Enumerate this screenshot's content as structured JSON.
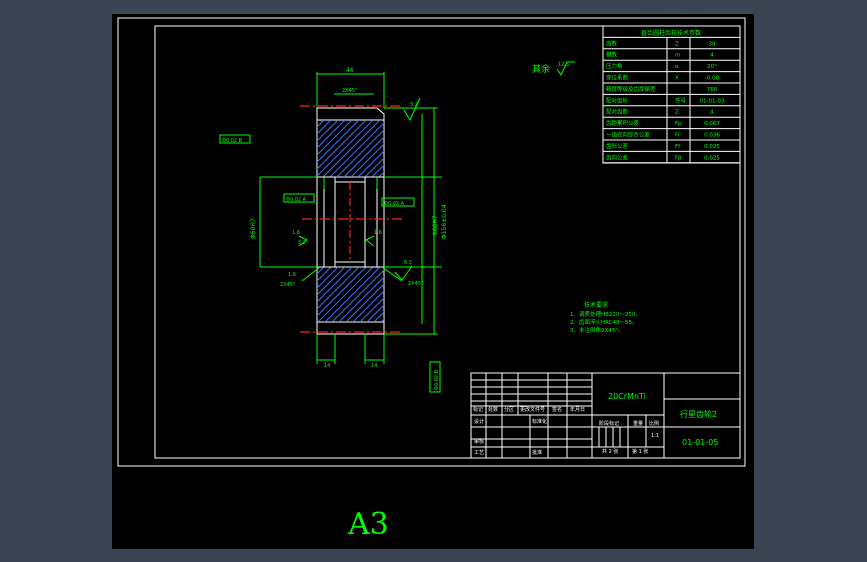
{
  "param_table": {
    "title": "直齿圆柱齿轮技术参数",
    "rows": [
      {
        "name": "齿数",
        "symbol": "Z",
        "value": "38"
      },
      {
        "name": "模数",
        "symbol": "m",
        "value": "4"
      },
      {
        "name": "压力角",
        "symbol": "α",
        "value": "20°"
      },
      {
        "name": "变位系数",
        "symbol": "X",
        "value": "-0.08"
      },
      {
        "name": "精度等级及齿厚偏差",
        "symbol": "",
        "value": "766"
      },
      {
        "name": "配对齿轮",
        "symbol": "件号",
        "value": "01-01-03"
      },
      {
        "name": "配对齿数",
        "symbol": "Z",
        "value": "4"
      },
      {
        "name": "齿距累积公差",
        "symbol": "Fp",
        "value": "0.067"
      },
      {
        "name": "一齿径向综合公差",
        "symbol": "Fi″",
        "value": "0.036"
      },
      {
        "name": "齿形公差",
        "symbol": "Ff",
        "value": "0.025"
      },
      {
        "name": "齿向公差",
        "symbol": "Fβ",
        "value": "0.025"
      }
    ]
  },
  "remaining": {
    "label": "其余",
    "roughness": "12.5"
  },
  "dims": {
    "top_width": "46",
    "chamfer_top": "2X45°",
    "gear_dia": "Φ156±0.04",
    "bore_left": "Φ60H7",
    "bore_right": "Φ60H7",
    "tol_a": "Φ0.02 B",
    "tol_b": "Φ0.02 A",
    "tol_c": "Φ0.02 A",
    "tol_d": "Φ0.02 B",
    "chamfer_l": "2X45°",
    "chamfer_r": "2X45°",
    "bottom_left": "14",
    "bottom_right": "14",
    "small_a": "1.6",
    "small_b": "3.2",
    "rough_a": "3.2",
    "rough_b": "1.6",
    "rough_c": "1.6",
    "rough_d": "6.3"
  },
  "tech_notes": {
    "title": "技术要求",
    "items": [
      "1、调质处理HB220～250。",
      "2、齿面淬火HRC48～55。",
      "3、未注倒角2X45°。"
    ]
  },
  "title_block": {
    "material": "20CrMnTi",
    "part_name": "行星齿轮2",
    "drawing_no": "01-01-05",
    "headers": [
      "标记",
      "处数",
      "分区",
      "更改文件号",
      "签名",
      "年月日"
    ],
    "roles": [
      "设计",
      "审核",
      "工艺"
    ],
    "std": "标准化",
    "approve": "批准",
    "stage": "阶段标记",
    "weight": "重量",
    "scale_label": "比例",
    "scale": "1:1",
    "sheets": "共 2 张",
    "sheet_no": "第 1 张"
  },
  "sheet_size": "A3"
}
